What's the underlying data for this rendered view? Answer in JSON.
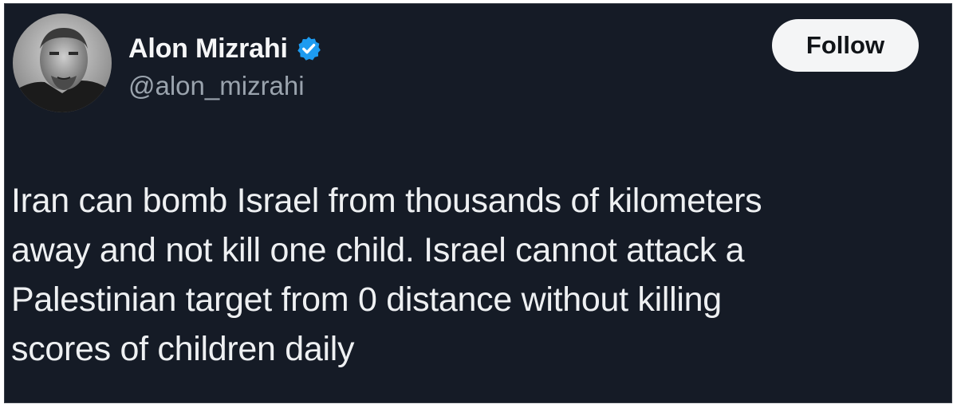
{
  "author": {
    "name": "Alon Mizrahi",
    "handle": "@alon_mizrahi",
    "verified": true,
    "verified_badge_icon": "verified-badge-icon",
    "avatar_icon": "avatar-photo"
  },
  "follow_button": {
    "label": "Follow"
  },
  "tweet": {
    "text": "Iran can bomb Israel from thousands of kilometers\naway and not kill one child. Israel cannot attack a\nPalestinian target from 0 distance without killing\nscores of children daily"
  },
  "colors": {
    "card_background": "#151b26",
    "verified_blue": "#1d9bf0",
    "handle_gray": "#9aa3ad",
    "button_background": "#f4f5f6"
  }
}
